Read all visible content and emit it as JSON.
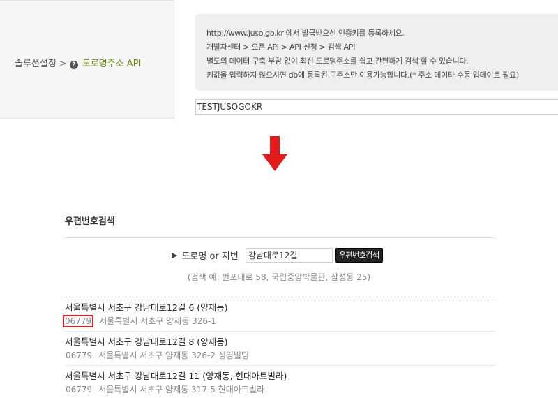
{
  "breadcrumb": {
    "parent": "솔루션설정",
    "separator": ">",
    "current": "도로명주소 API",
    "current_icon": "question-circle-icon"
  },
  "info_box": {
    "lines": [
      "http://www.juso.go.kr 에서 발급받으신 인증키를 등록하세요.",
      "개발자센터 > 오픈 API > API 신청 > 검색 API",
      "별도의 데이터 구축 부담 없이 최신 도로명주소를 쉽고 간편하게 검색 할 수 있습니다.",
      "키값을 입력하지 않으시면 db에 등록된 구주소만 이용가능합니다.(* 주소 데이타 수동 업데이트 필요)"
    ]
  },
  "api_key": {
    "value": "TESTJUSOGOKR"
  },
  "arrow": {
    "color": "#e31b1b",
    "icon": "down-arrow-icon"
  },
  "postcode_search": {
    "title": "우편번호검색",
    "search_label": "도로명 or 지번",
    "search_value": "강남대로12길",
    "search_button": "우편번호검색",
    "hint": "(검색 예: 반포대로 58, 국립중앙박물관, 삼성동 25)",
    "results": [
      {
        "road_address": "서울특별시 서초구 강남대로12길 6 (양재동)",
        "zipcode": "06779",
        "jibun": "서울특별시 서초구 양재동 326-1",
        "highlighted": true
      },
      {
        "road_address": "서울특별시 서초구 강남대로12길 8 (양재동)",
        "zipcode": "06779",
        "jibun": "서울특별시 서초구 양재동 326-2 성경빌딩",
        "highlighted": false
      },
      {
        "road_address": "서울특별시 서초구 강남대로12길 11 (양재동, 현대아트빌라)",
        "zipcode": "06779",
        "jibun": "서울특별시 서초구 양재동 317-5 현대아트빌라",
        "highlighted": false
      }
    ]
  },
  "colors": {
    "highlight_border": "#e02020",
    "api_name": "#6b8a13"
  }
}
